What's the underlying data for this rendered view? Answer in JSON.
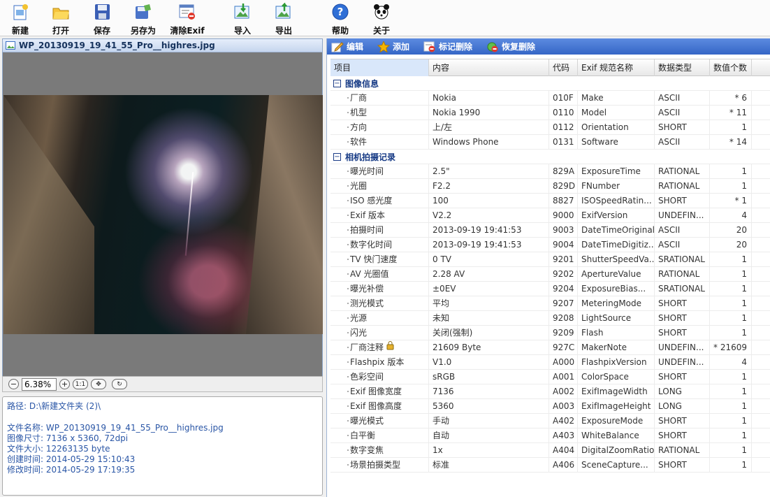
{
  "toolbar": {
    "buttons": [
      {
        "label": "新建",
        "icon": "new-icon"
      },
      {
        "label": "打开",
        "icon": "open-folder-icon"
      },
      {
        "label": "保存",
        "icon": "save-disk-icon"
      },
      {
        "label": "另存为",
        "icon": "save-as-icon"
      },
      {
        "label": "清除Exif",
        "icon": "clear-exif-icon"
      },
      {
        "label": "导入",
        "icon": "import-icon"
      },
      {
        "label": "导出",
        "icon": "export-icon"
      },
      {
        "label": "帮助",
        "icon": "help-icon"
      },
      {
        "label": "关于",
        "icon": "panda-icon"
      }
    ]
  },
  "left": {
    "title": "WP_20130919_19_41_55_Pro__highres.jpg",
    "zoom_value": "6.38%",
    "zoom_buttons": {
      "one_to_one": "1:1"
    }
  },
  "info": {
    "path": "路径: D:\\新建文件夹 (2)\\",
    "filename": "文件名称: WP_20130919_19_41_55_Pro__highres.jpg",
    "dimensions": "图像尺寸: 7136 x 5360, 72dpi",
    "filesize": "文件大小: 12263135 byte",
    "created": "创建时间: 2014-05-29 15:10:43",
    "modified": "修改时间: 2014-05-29 17:19:35"
  },
  "right_bar": {
    "buttons": [
      {
        "label": "编辑",
        "icon": "edit-icon"
      },
      {
        "label": "添加",
        "icon": "add-star-icon"
      },
      {
        "label": "标记删除",
        "icon": "mark-delete-icon"
      },
      {
        "label": "恢复删除",
        "icon": "restore-delete-icon"
      }
    ]
  },
  "table": {
    "headers": [
      "项目",
      "内容",
      "代码",
      "Exif 规范名称",
      "数据类型",
      "数值个数"
    ],
    "groups": [
      {
        "label": "图像信息",
        "rows": [
          [
            "厂商",
            "Nokia",
            "010F",
            "Make",
            "ASCII",
            "* 6"
          ],
          [
            "机型",
            "Nokia 1990",
            "0110",
            "Model",
            "ASCII",
            "* 11"
          ],
          [
            "方向",
            "上/左",
            "0112",
            "Orientation",
            "SHORT",
            "1"
          ],
          [
            "软件",
            "Windows Phone",
            "0131",
            "Software",
            "ASCII",
            "* 14"
          ]
        ]
      },
      {
        "label": "相机拍摄记录",
        "rows": [
          [
            "曝光时间",
            "2.5\"",
            "829A",
            "ExposureTime",
            "RATIONAL",
            "1"
          ],
          [
            "光圈",
            "F2.2",
            "829D",
            "FNumber",
            "RATIONAL",
            "1"
          ],
          [
            "ISO 感光度",
            "100",
            "8827",
            "ISOSpeedRatin...",
            "SHORT",
            "* 1"
          ],
          [
            "Exif 版本",
            "V2.2",
            "9000",
            "ExifVersion",
            "UNDEFIN...",
            "4"
          ],
          [
            "拍摄时间",
            "2013-09-19 19:41:53",
            "9003",
            "DateTimeOriginal",
            "ASCII",
            "20"
          ],
          [
            "数字化时间",
            "2013-09-19 19:41:53",
            "9004",
            "DateTimeDigitiz...",
            "ASCII",
            "20"
          ],
          [
            "TV 快门速度",
            "0 TV",
            "9201",
            "ShutterSpeedVa...",
            "SRATIONAL",
            "1"
          ],
          [
            "AV 光圈值",
            "2.28 AV",
            "9202",
            "ApertureValue",
            "RATIONAL",
            "1"
          ],
          [
            "曝光补偿",
            "±0EV",
            "9204",
            "ExposureBias...",
            "SRATIONAL",
            "1"
          ],
          [
            "测光模式",
            "平均",
            "9207",
            "MeteringMode",
            "SHORT",
            "1"
          ],
          [
            "光源",
            "未知",
            "9208",
            "LightSource",
            "SHORT",
            "1"
          ],
          [
            "闪光",
            "关闭(强制)",
            "9209",
            "Flash",
            "SHORT",
            "1"
          ],
          [
            "厂商注释",
            "21609 Byte",
            "927C",
            "MakerNote",
            "UNDEFIN...",
            "* 21609"
          ],
          [
            "Flashpix 版本",
            "V1.0",
            "A000",
            "FlashpixVersion",
            "UNDEFIN...",
            "4"
          ],
          [
            "色彩空间",
            "sRGB",
            "A001",
            "ColorSpace",
            "SHORT",
            "1"
          ],
          [
            "Exif 图像宽度",
            "7136",
            "A002",
            "ExifImageWidth",
            "LONG",
            "1"
          ],
          [
            "Exif 图像高度",
            "5360",
            "A003",
            "ExifImageHeight",
            "LONG",
            "1"
          ],
          [
            "曝光模式",
            "手动",
            "A402",
            "ExposureMode",
            "SHORT",
            "1"
          ],
          [
            "白平衡",
            "自动",
            "A403",
            "WhiteBalance",
            "SHORT",
            "1"
          ],
          [
            "数字变焦",
            "1x",
            "A404",
            "DigitalZoomRatio",
            "RATIONAL",
            "1"
          ],
          [
            "场景拍摄类型",
            "标准",
            "A406",
            "SceneCapture...",
            "SHORT",
            "1"
          ]
        ]
      }
    ]
  }
}
